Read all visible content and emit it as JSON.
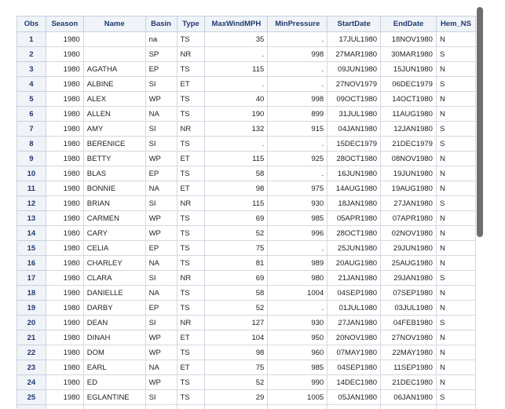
{
  "columns": [
    "Obs",
    "Season",
    "Name",
    "Basin",
    "Type",
    "MaxWindMPH",
    "MinPressure",
    "StartDate",
    "EndDate",
    "Hem_NS"
  ],
  "rows": [
    [
      "1",
      "1980",
      "",
      "na",
      "TS",
      "35",
      ".",
      "17JUL1980",
      "18NOV1980",
      "N"
    ],
    [
      "2",
      "1980",
      "",
      "SP",
      "NR",
      ".",
      "998",
      "27MAR1980",
      "30MAR1980",
      "S"
    ],
    [
      "3",
      "1980",
      "AGATHA",
      "EP",
      "TS",
      "115",
      ".",
      "09JUN1980",
      "15JUN1980",
      "N"
    ],
    [
      "4",
      "1980",
      "ALBINE",
      "SI",
      "ET",
      ".",
      ".",
      "27NOV1979",
      "06DEC1979",
      "S"
    ],
    [
      "5",
      "1980",
      "ALEX",
      "WP",
      "TS",
      "40",
      "998",
      "09OCT1980",
      "14OCT1980",
      "N"
    ],
    [
      "6",
      "1980",
      "ALLEN",
      "NA",
      "TS",
      "190",
      "899",
      "31JUL1980",
      "11AUG1980",
      "N"
    ],
    [
      "7",
      "1980",
      "AMY",
      "SI",
      "NR",
      "132",
      "915",
      "04JAN1980",
      "12JAN1980",
      "S"
    ],
    [
      "8",
      "1980",
      "BERENICE",
      "SI",
      "TS",
      ".",
      ".",
      "15DEC1979",
      "21DEC1979",
      "S"
    ],
    [
      "9",
      "1980",
      "BETTY",
      "WP",
      "ET",
      "115",
      "925",
      "28OCT1980",
      "08NOV1980",
      "N"
    ],
    [
      "10",
      "1980",
      "BLAS",
      "EP",
      "TS",
      "58",
      ".",
      "16JUN1980",
      "19JUN1980",
      "N"
    ],
    [
      "11",
      "1980",
      "BONNIE",
      "NA",
      "ET",
      "98",
      "975",
      "14AUG1980",
      "19AUG1980",
      "N"
    ],
    [
      "12",
      "1980",
      "BRIAN",
      "SI",
      "NR",
      "115",
      "930",
      "18JAN1980",
      "27JAN1980",
      "S"
    ],
    [
      "13",
      "1980",
      "CARMEN",
      "WP",
      "TS",
      "69",
      "985",
      "05APR1980",
      "07APR1980",
      "N"
    ],
    [
      "14",
      "1980",
      "CARY",
      "WP",
      "TS",
      "52",
      "996",
      "28OCT1980",
      "02NOV1980",
      "N"
    ],
    [
      "15",
      "1980",
      "CELIA",
      "EP",
      "TS",
      "75",
      ".",
      "25JUN1980",
      "29JUN1980",
      "N"
    ],
    [
      "16",
      "1980",
      "CHARLEY",
      "NA",
      "TS",
      "81",
      "989",
      "20AUG1980",
      "25AUG1980",
      "N"
    ],
    [
      "17",
      "1980",
      "CLARA",
      "SI",
      "NR",
      "69",
      "980",
      "21JAN1980",
      "29JAN1980",
      "S"
    ],
    [
      "18",
      "1980",
      "DANIELLE",
      "NA",
      "TS",
      "58",
      "1004",
      "04SEP1980",
      "07SEP1980",
      "N"
    ],
    [
      "19",
      "1980",
      "DARBY",
      "EP",
      "TS",
      "52",
      ".",
      "01JUL1980",
      "03JUL1980",
      "N"
    ],
    [
      "20",
      "1980",
      "DEAN",
      "SI",
      "NR",
      "127",
      "930",
      "27JAN1980",
      "04FEB1980",
      "S"
    ],
    [
      "21",
      "1980",
      "DINAH",
      "WP",
      "ET",
      "104",
      "950",
      "20NOV1980",
      "27NOV1980",
      "N"
    ],
    [
      "22",
      "1980",
      "DOM",
      "WP",
      "TS",
      "98",
      "960",
      "07MAY1980",
      "22MAY1980",
      "N"
    ],
    [
      "23",
      "1980",
      "EARL",
      "NA",
      "ET",
      "75",
      "985",
      "04SEP1980",
      "11SEP1980",
      "N"
    ],
    [
      "24",
      "1980",
      "ED",
      "WP",
      "TS",
      "52",
      "990",
      "14DEC1980",
      "21DEC1980",
      "N"
    ],
    [
      "25",
      "1980",
      "EGLANTINE",
      "SI",
      "TS",
      "29",
      "1005",
      "05JAN1980",
      "06JAN1980",
      "S"
    ],
    [
      "26",
      "",
      "",
      "",
      "",
      "",
      "",
      "",
      "",
      ""
    ]
  ]
}
